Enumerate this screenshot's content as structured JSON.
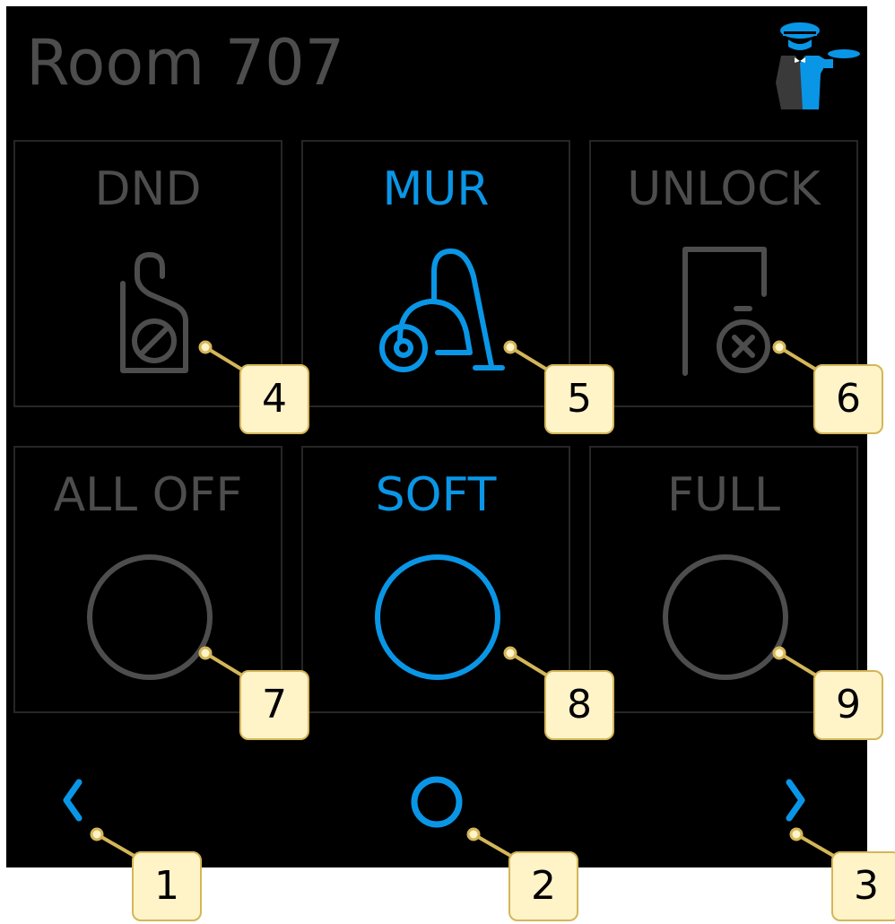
{
  "header": {
    "title": "Room 707",
    "logo_icon": "butler-logo-icon"
  },
  "tiles": [
    {
      "label": "DND",
      "icon": "do-not-disturb-icon",
      "active": false
    },
    {
      "label": "MUR",
      "icon": "vacuum-cleaner-icon",
      "active": true
    },
    {
      "label": "UNLOCK",
      "icon": "door-unlock-icon",
      "active": false
    },
    {
      "label": "ALL OFF",
      "icon": "circle-icon",
      "active": false
    },
    {
      "label": "SOFT",
      "icon": "circle-icon",
      "active": true
    },
    {
      "label": "FULL",
      "icon": "circle-icon",
      "active": false
    }
  ],
  "nav": {
    "prev_icon": "chevron-left-icon",
    "home_icon": "home-circle-icon",
    "next_icon": "chevron-right-icon"
  },
  "callouts": {
    "prev": "1",
    "home": "2",
    "next": "3",
    "dnd": "4",
    "mur": "5",
    "unlock": "6",
    "all_off": "7",
    "soft": "8",
    "full": "9"
  },
  "colors": {
    "background": "#000000",
    "active": "#0a96e6",
    "inactive": "#4d4d4d",
    "tile_border": "#262626",
    "callout_fill": "#fff3c8",
    "callout_border": "#d4b659"
  }
}
